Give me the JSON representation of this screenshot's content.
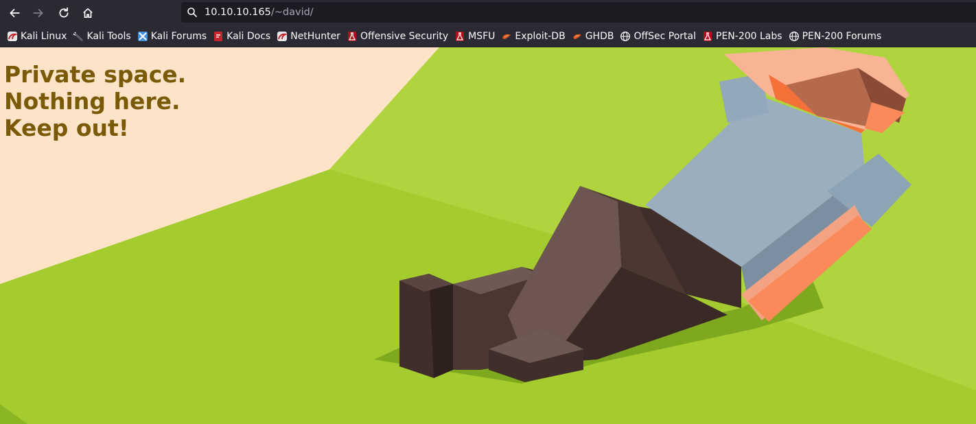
{
  "browser": {
    "url_host": "10.10.10.165",
    "url_path": "/~david/",
    "bookmarks": [
      {
        "label": "Kali Linux",
        "icon": "kali-dragon-icon"
      },
      {
        "label": "Kali Tools",
        "icon": "kali-tools-icon"
      },
      {
        "label": "Kali Forums",
        "icon": "kali-forums-icon"
      },
      {
        "label": "Kali Docs",
        "icon": "kali-docs-icon"
      },
      {
        "label": "NetHunter",
        "icon": "nethunter-icon"
      },
      {
        "label": "Offensive Security",
        "icon": "offsec-icon"
      },
      {
        "label": "MSFU",
        "icon": "offsec-icon"
      },
      {
        "label": "Exploit-DB",
        "icon": "exploit-db-icon"
      },
      {
        "label": "GHDB",
        "icon": "exploit-db-icon"
      },
      {
        "label": "OffSec Portal",
        "icon": "globe-icon"
      },
      {
        "label": "PEN-200 Labs",
        "icon": "offsec-icon"
      },
      {
        "label": "PEN-200 Forums",
        "icon": "globe-icon"
      }
    ]
  },
  "page": {
    "headline": [
      "Private space.",
      "Nothing here.",
      "Keep out!"
    ]
  },
  "colors": {
    "toolbar_bg": "#2b2a33",
    "headline": "#7a5a06",
    "grass": "#a4cc2e",
    "peach": "#fde3c8"
  }
}
